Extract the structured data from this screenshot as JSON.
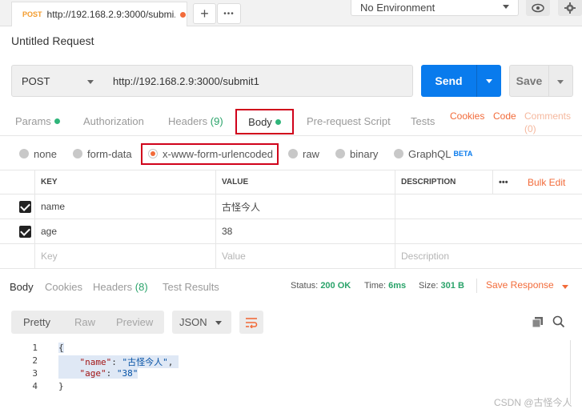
{
  "tab": {
    "method": "POST",
    "url": "http://192.168.2.9:3000/submi..."
  },
  "topbar": {
    "add_icon": "+",
    "more_icon": "•••",
    "environment": "No Environment"
  },
  "request": {
    "title": "Untitled Request",
    "method": "POST",
    "url": "http://192.168.2.9:3000/submit1",
    "send_label": "Send",
    "save_label": "Save"
  },
  "request_tabs": {
    "params": "Params",
    "authorization": "Authorization",
    "headers": "Headers",
    "headers_count": "(9)",
    "body": "Body",
    "prerequest": "Pre-request Script",
    "tests": "Tests",
    "cookies": "Cookies",
    "code": "Code",
    "comments": "Comments",
    "comments_count": "(0)"
  },
  "body_types": {
    "none": "none",
    "form_data": "form-data",
    "urlencoded": "x-www-form-urlencoded",
    "raw": "raw",
    "binary": "binary",
    "graphql": "GraphQL",
    "beta": "BETA",
    "selected": "x-www-form-urlencoded"
  },
  "params_table": {
    "headers": [
      "KEY",
      "VALUE",
      "DESCRIPTION"
    ],
    "more_icon": "•••",
    "bulk_edit": "Bulk Edit",
    "rows": [
      {
        "key": "name",
        "value": "古怪今人",
        "description": "",
        "checked": true
      },
      {
        "key": "age",
        "value": "38",
        "description": "",
        "checked": true
      }
    ],
    "placeholders": {
      "key": "Key",
      "value": "Value",
      "description": "Description"
    }
  },
  "response_tabs": {
    "body": "Body",
    "cookies": "Cookies",
    "headers": "Headers",
    "headers_count": "(8)",
    "test_results": "Test Results"
  },
  "response_status": {
    "status_label": "Status:",
    "status_value": "200 OK",
    "time_label": "Time:",
    "time_value": "6ms",
    "size_label": "Size:",
    "size_value": "301 B",
    "save_response": "Save Response"
  },
  "response_view": {
    "pretty": "Pretty",
    "raw": "Raw",
    "preview": "Preview",
    "format": "JSON"
  },
  "code_lines": [
    {
      "num": "1",
      "text": "{"
    },
    {
      "num": "2",
      "key": "\"name\"",
      "sep": ": ",
      "val": "\"古怪今人\"",
      "end": ","
    },
    {
      "num": "3",
      "key": "\"age\"",
      "sep": ": ",
      "val": "\"38\"",
      "end": ""
    },
    {
      "num": "4",
      "text": "}"
    }
  ],
  "watermark": "CSDN @古怪今人",
  "colors": {
    "accent_orange": "#f26b3a",
    "send_blue": "#097bed",
    "status_green": "#2aa36a",
    "highlight_red": "#d0021b"
  }
}
